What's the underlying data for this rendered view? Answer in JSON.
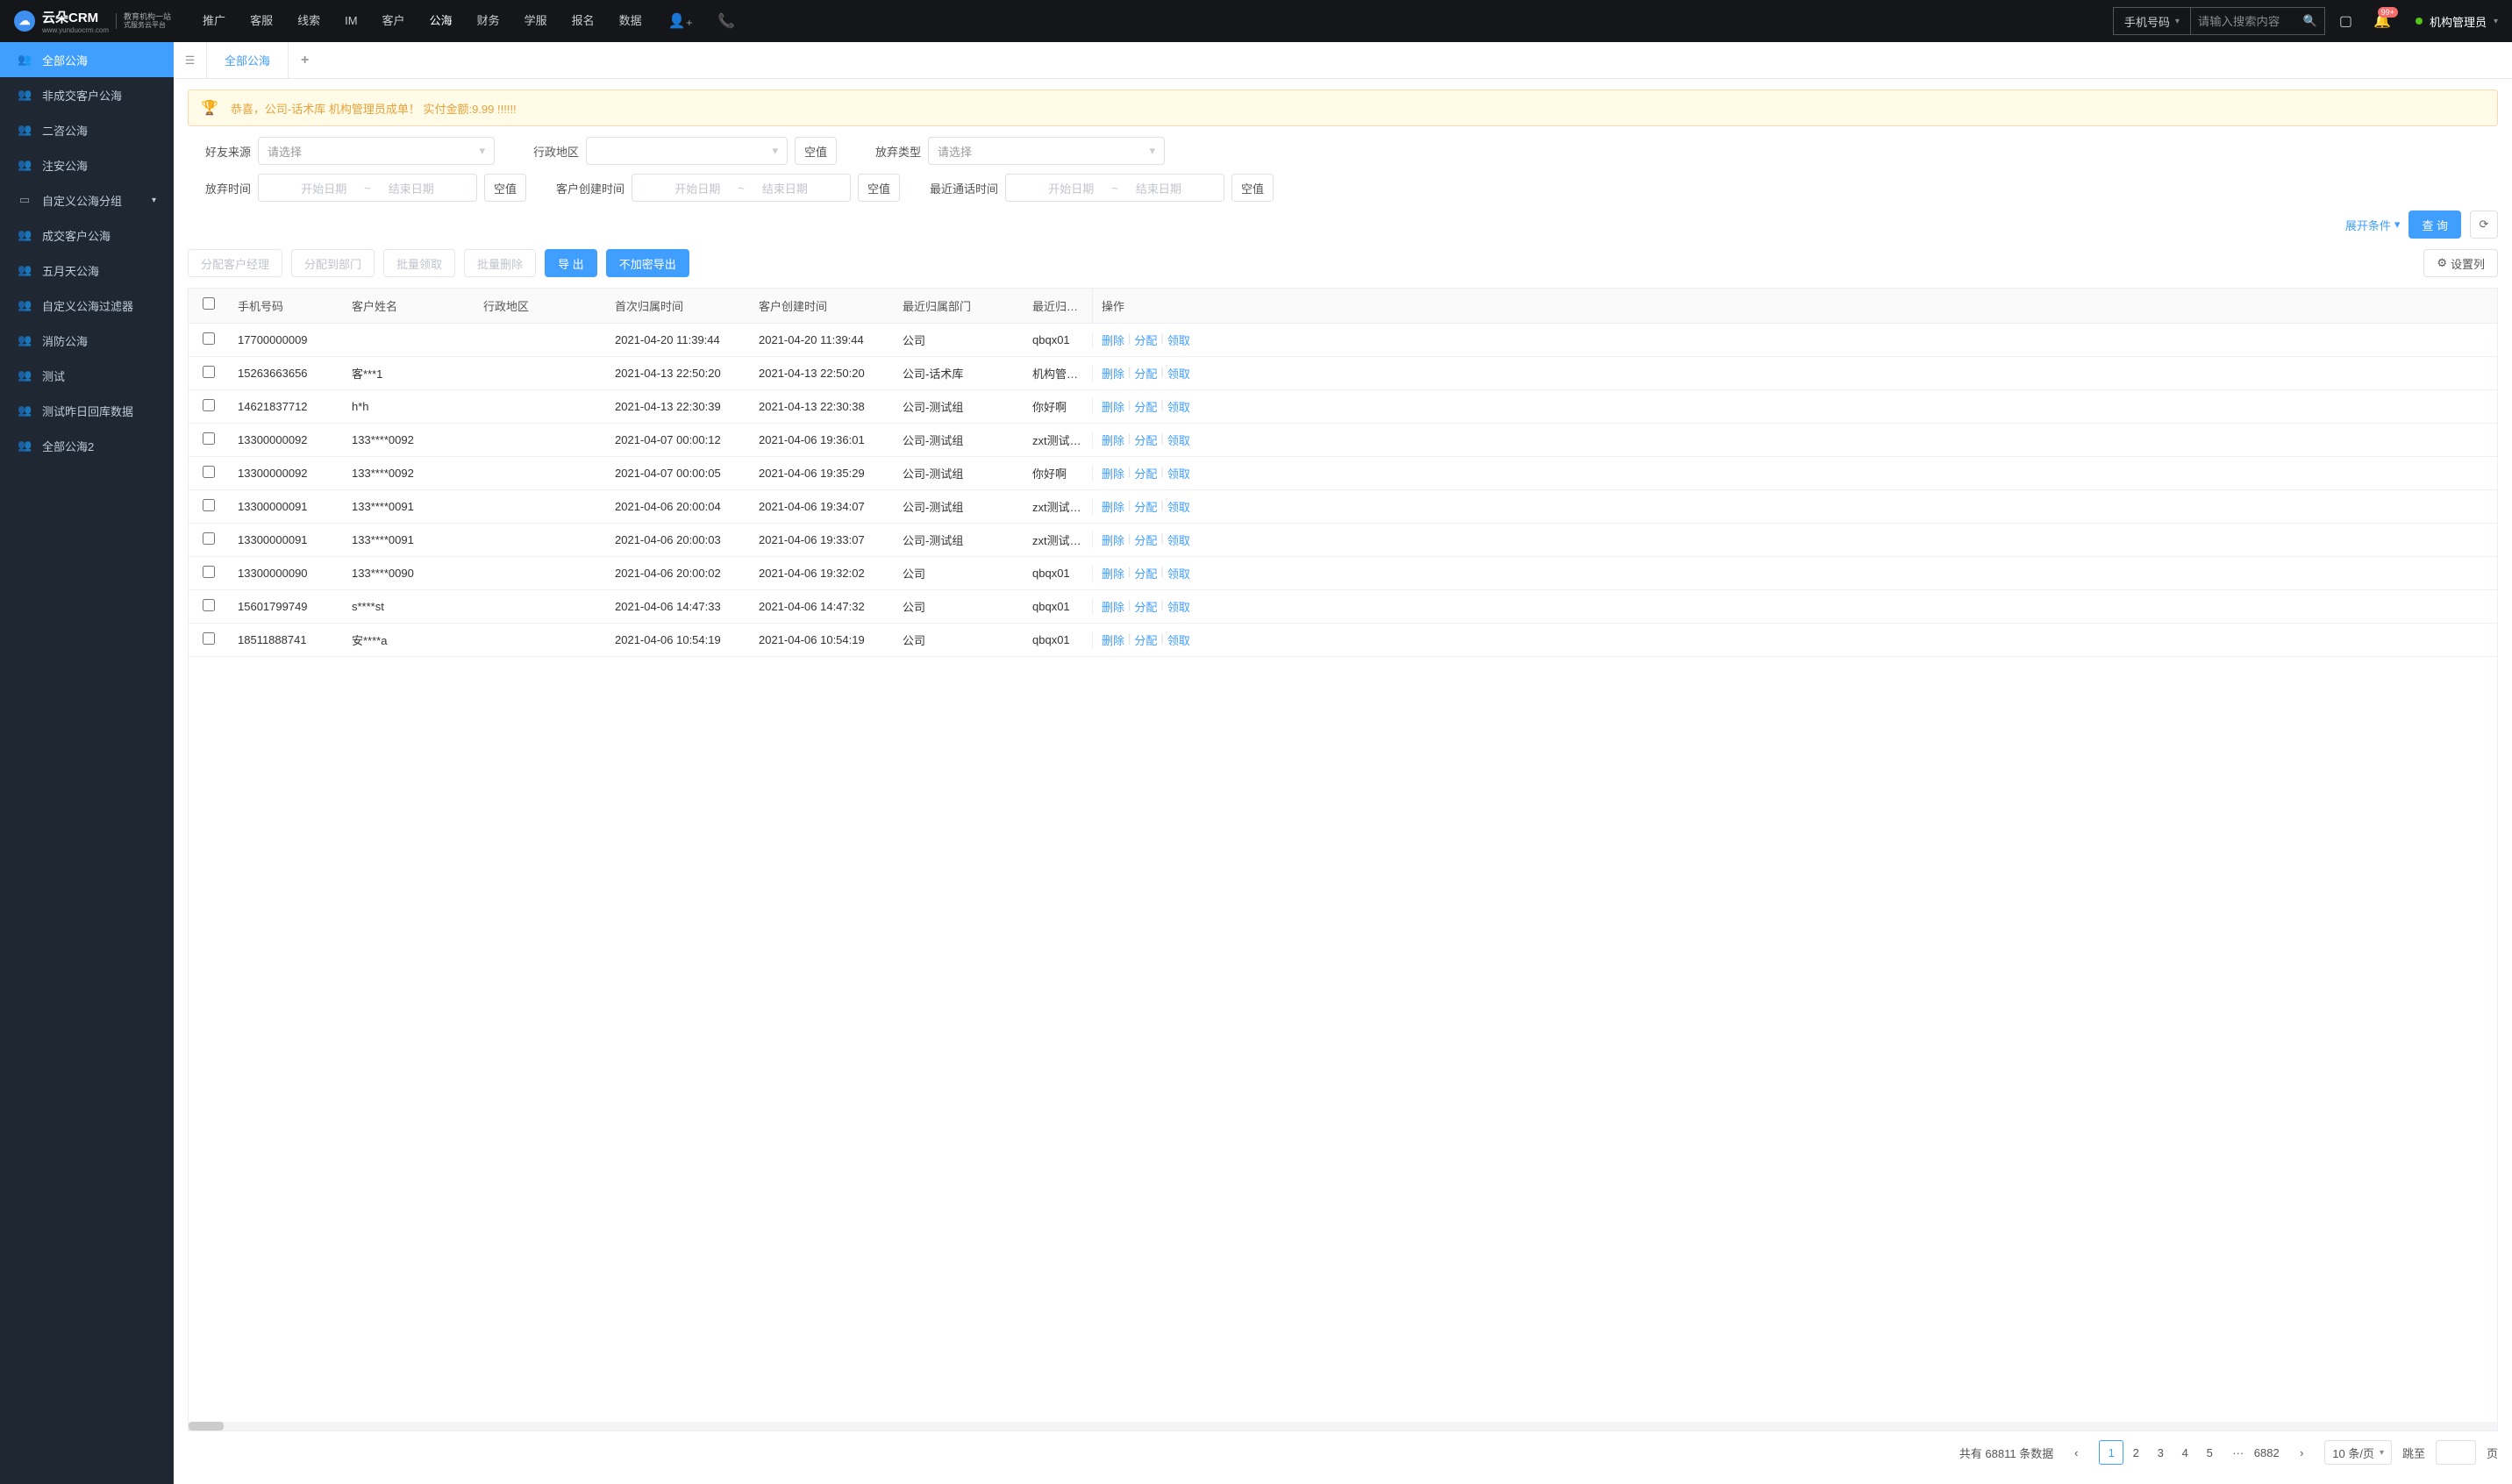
{
  "header": {
    "logo_text": "云朵CRM",
    "logo_sub1": "教育机构一站",
    "logo_sub2": "式服务云平台",
    "logo_url": "www.yunduocrm.com",
    "nav": [
      "推广",
      "客服",
      "线索",
      "IM",
      "客户",
      "公海",
      "财务",
      "学服",
      "报名",
      "数据"
    ],
    "nav_active_index": 5,
    "search_type": "手机号码",
    "search_placeholder": "请输入搜索内容",
    "badge": "99+",
    "user_name": "机构管理员"
  },
  "sidebar": [
    {
      "icon": "👥",
      "label": "全部公海",
      "active": true
    },
    {
      "icon": "👥",
      "label": "非成交客户公海"
    },
    {
      "icon": "👥",
      "label": "二咨公海"
    },
    {
      "icon": "👥",
      "label": "注安公海"
    },
    {
      "icon": "▭",
      "label": "自定义公海分组",
      "chevron": true
    },
    {
      "icon": "👥",
      "label": "成交客户公海"
    },
    {
      "icon": "👥",
      "label": "五月天公海"
    },
    {
      "icon": "👥",
      "label": "自定义公海过滤器"
    },
    {
      "icon": "👥",
      "label": "消防公海"
    },
    {
      "icon": "👥",
      "label": "测试"
    },
    {
      "icon": "👥",
      "label": "测试昨日回库数据"
    },
    {
      "icon": "👥",
      "label": "全部公海2"
    }
  ],
  "tabs": {
    "active": "全部公海"
  },
  "alert": "恭喜，公司-话术库  机构管理员成单！  实付金额:9.99 !!!!!!",
  "filters": {
    "source_label": "好友来源",
    "source_ph": "请选择",
    "region_label": "行政地区",
    "region_null": "空值",
    "abandon_type_label": "放弃类型",
    "abandon_type_ph": "请选择",
    "abandon_time_label": "放弃时间",
    "create_time_label": "客户创建时间",
    "call_time_label": "最近通话时间",
    "start_ph": "开始日期",
    "end_ph": "结束日期",
    "null_btn": "空值",
    "expand": "展开条件",
    "query": "查 询"
  },
  "toolbar": {
    "assign_mgr": "分配客户经理",
    "assign_dept": "分配到部门",
    "batch_claim": "批量领取",
    "batch_del": "批量删除",
    "export": "导 出",
    "export_plain": "不加密导出",
    "set_cols": "设置列"
  },
  "columns": {
    "phone": "手机号码",
    "name": "客户姓名",
    "region": "行政地区",
    "first": "首次归属时间",
    "create": "客户创建时间",
    "dept": "最近归属部门",
    "owner": "最近归属人",
    "ops": "操作"
  },
  "ops": {
    "del": "删除",
    "assign": "分配",
    "claim": "领取"
  },
  "rows": [
    {
      "phone": "17700000009",
      "name": "",
      "region": "",
      "first": "2021-04-20 11:39:44",
      "create": "2021-04-20 11:39:44",
      "dept": "公司",
      "owner": "qbqx01"
    },
    {
      "phone": "15263663656",
      "name": "客***1",
      "region": "",
      "first": "2021-04-13 22:50:20",
      "create": "2021-04-13 22:50:20",
      "dept": "公司-话术库",
      "owner": "机构管理员"
    },
    {
      "phone": "14621837712",
      "name": "h*h",
      "region": "",
      "first": "2021-04-13 22:30:39",
      "create": "2021-04-13 22:30:38",
      "dept": "公司-测试组",
      "owner": "你好啊"
    },
    {
      "phone": "13300000092",
      "name": "133****0092",
      "region": "",
      "first": "2021-04-07 00:00:12",
      "create": "2021-04-06 19:36:01",
      "dept": "公司-测试组",
      "owner": "zxt测试导入"
    },
    {
      "phone": "13300000092",
      "name": "133****0092",
      "region": "",
      "first": "2021-04-07 00:00:05",
      "create": "2021-04-06 19:35:29",
      "dept": "公司-测试组",
      "owner": "你好啊"
    },
    {
      "phone": "13300000091",
      "name": "133****0091",
      "region": "",
      "first": "2021-04-06 20:00:04",
      "create": "2021-04-06 19:34:07",
      "dept": "公司-测试组",
      "owner": "zxt测试导入"
    },
    {
      "phone": "13300000091",
      "name": "133****0091",
      "region": "",
      "first": "2021-04-06 20:00:03",
      "create": "2021-04-06 19:33:07",
      "dept": "公司-测试组",
      "owner": "zxt测试导入"
    },
    {
      "phone": "13300000090",
      "name": "133****0090",
      "region": "",
      "first": "2021-04-06 20:00:02",
      "create": "2021-04-06 19:32:02",
      "dept": "公司",
      "owner": "qbqx01"
    },
    {
      "phone": "15601799749",
      "name": "s****st",
      "region": "",
      "first": "2021-04-06 14:47:33",
      "create": "2021-04-06 14:47:32",
      "dept": "公司",
      "owner": "qbqx01"
    },
    {
      "phone": "18511888741",
      "name": "安****a",
      "region": "",
      "first": "2021-04-06 10:54:19",
      "create": "2021-04-06 10:54:19",
      "dept": "公司",
      "owner": "qbqx01"
    }
  ],
  "pagination": {
    "total_prefix": "共有",
    "total": "68811",
    "total_suffix": "条数据",
    "pages": [
      "1",
      "2",
      "3",
      "4",
      "5"
    ],
    "last": "6882",
    "page_size": "10 条/页",
    "jump_label": "跳至",
    "page_suffix": "页"
  }
}
